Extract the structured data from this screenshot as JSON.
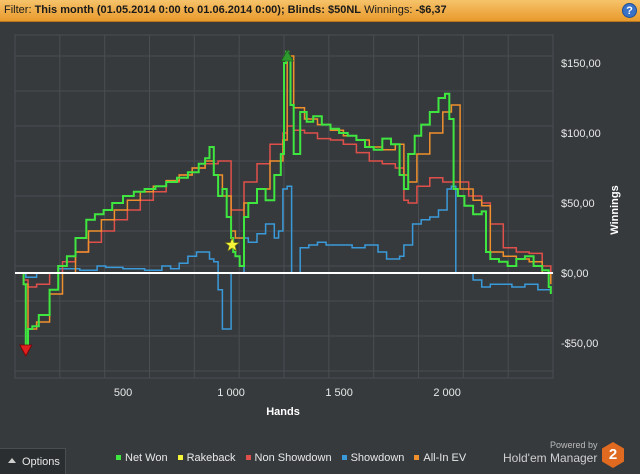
{
  "filter_bar": {
    "prefix": "Filter: ",
    "filter_text": "This month (01.05.2014 0:00 to 01.06.2014 0:00); Blinds: $50NL",
    "winnings_label": " Winnings: ",
    "winnings_value": "-$6,37",
    "help_icon": "?"
  },
  "options_button": {
    "label": "Options",
    "icon": "triangle-up-icon"
  },
  "powered_by": "Powered by",
  "brand": "Hold'em Manager",
  "brand_logo_text": "2",
  "colors": {
    "background": "#363a3d",
    "grid": "#4a4e52",
    "zero_line": "#ffffff",
    "net_won": "#3fe63f",
    "rakeback": "#f5f53a",
    "non_showdown": "#e0504a",
    "showdown": "#3a9ad9",
    "all_in_ev": "#f0902c",
    "filter_bar": "#f0a840"
  },
  "chart_data": {
    "type": "line",
    "xlabel": "Hands",
    "ylabel": "Winnings",
    "xlim": [
      0,
      2490
    ],
    "ylim": [
      -75,
      170
    ],
    "x_ticks": [
      500,
      1000,
      1500,
      2000
    ],
    "x_tick_labels": [
      "500",
      "1 000",
      "1 500",
      "2 000"
    ],
    "y_ticks": [
      150,
      100,
      50,
      0,
      -50
    ],
    "y_tick_labels": [
      "$150,00",
      "$100,00",
      "$50,00",
      "$0,00",
      "-$50,00"
    ],
    "grid": true,
    "legend": "bottom",
    "markers": [
      {
        "name": "min",
        "shape": "triangle-down",
        "x": 50,
        "y": -55,
        "color": "#e02020"
      },
      {
        "name": "rakeback",
        "shape": "star",
        "x": 1005,
        "y": 20,
        "color": "#f5f53a"
      },
      {
        "name": "max",
        "shape": "triangle-up",
        "x": 1260,
        "y": 155,
        "color": "#2e9a2e"
      }
    ],
    "series": [
      {
        "name": "Net Won",
        "color": "#3fe63f",
        "x": [
          0,
          40,
          50,
          60,
          80,
          110,
          160,
          200,
          240,
          280,
          330,
          370,
          410,
          450,
          500,
          550,
          600,
          650,
          700,
          750,
          800,
          850,
          880,
          900,
          920,
          940,
          960,
          980,
          1000,
          1010,
          1020,
          1040,
          1060,
          1080,
          1120,
          1160,
          1200,
          1230,
          1245,
          1255,
          1265,
          1275,
          1290,
          1320,
          1350,
          1380,
          1420,
          1460,
          1500,
          1540,
          1580,
          1620,
          1660,
          1700,
          1740,
          1780,
          1800,
          1820,
          1850,
          1880,
          1920,
          1960,
          1990,
          2010,
          2030,
          2050,
          2080,
          2120,
          2160,
          2180,
          2200,
          2240,
          2280,
          2320,
          2360,
          2400,
          2440,
          2470,
          2480
        ],
        "y": [
          0,
          -8,
          -52,
          -40,
          -38,
          -30,
          -12,
          5,
          12,
          25,
          38,
          42,
          45,
          50,
          55,
          58,
          60,
          62,
          65,
          68,
          72,
          78,
          82,
          90,
          70,
          55,
          60,
          40,
          25,
          15,
          12,
          5,
          40,
          50,
          60,
          52,
          70,
          85,
          150,
          158,
          152,
          120,
          85,
          115,
          108,
          112,
          106,
          103,
          100,
          98,
          95,
          90,
          88,
          96,
          92,
          70,
          60,
          85,
          98,
          106,
          115,
          125,
          128,
          110,
          60,
          55,
          48,
          42,
          44,
          15,
          10,
          8,
          5,
          10,
          12,
          5,
          2,
          -10,
          -15
        ]
      },
      {
        "name": "Rakeback",
        "color": "#f5f53a",
        "x": [
          1005
        ],
        "y": [
          20
        ]
      },
      {
        "name": "Non Showdown",
        "color": "#e0504a",
        "x": [
          0,
          40,
          60,
          100,
          160,
          220,
          280,
          340,
          400,
          460,
          520,
          580,
          640,
          700,
          760,
          820,
          880,
          940,
          1000,
          1060,
          1120,
          1180,
          1240,
          1260,
          1290,
          1340,
          1400,
          1460,
          1520,
          1580,
          1640,
          1700,
          1760,
          1800,
          1820,
          1860,
          1920,
          1980,
          2040,
          2100,
          2160,
          2200,
          2260,
          2320,
          2380,
          2440,
          2480
        ],
        "y": [
          0,
          -5,
          -10,
          -8,
          0,
          8,
          15,
          22,
          30,
          38,
          45,
          52,
          58,
          65,
          70,
          75,
          78,
          80,
          45,
          65,
          78,
          92,
          100,
          105,
          102,
          100,
          96,
          95,
          92,
          86,
          80,
          78,
          75,
          52,
          50,
          62,
          68,
          65,
          65,
          55,
          50,
          35,
          18,
          15,
          14,
          5,
          -5
        ]
      },
      {
        "name": "Showdown",
        "color": "#3a9ad9",
        "x": [
          0,
          50,
          100,
          200,
          300,
          380,
          420,
          500,
          560,
          600,
          640,
          680,
          720,
          760,
          800,
          840,
          900,
          920,
          940,
          960,
          980,
          1000,
          1060,
          1080,
          1120,
          1160,
          1200,
          1220,
          1240,
          1260,
          1280,
          1320,
          1360,
          1400,
          1440,
          1500,
          1560,
          1620,
          1680,
          1720,
          1780,
          1800,
          1840,
          1880,
          1920,
          1960,
          2000,
          2020,
          2040,
          2080,
          2120,
          2160,
          2200,
          2240,
          2300,
          2360,
          2420,
          2480
        ],
        "y": [
          0,
          -3,
          0,
          3,
          2,
          5,
          4,
          3,
          3,
          2,
          2,
          5,
          3,
          7,
          12,
          15,
          10,
          8,
          -12,
          -40,
          -40,
          0,
          25,
          22,
          28,
          35,
          25,
          30,
          60,
          62,
          0,
          18,
          20,
          22,
          20,
          20,
          18,
          20,
          15,
          10,
          12,
          20,
          35,
          38,
          40,
          45,
          60,
          62,
          0,
          0,
          -5,
          -10,
          -8,
          -8,
          -10,
          -8,
          -12,
          -12
        ]
      },
      {
        "name": "All-In EV",
        "color": "#f0902c",
        "x": [
          0,
          40,
          60,
          100,
          160,
          220,
          280,
          340,
          400,
          460,
          520,
          580,
          640,
          700,
          760,
          820,
          880,
          920,
          960,
          1000,
          1020,
          1060,
          1120,
          1180,
          1240,
          1260,
          1290,
          1340,
          1400,
          1460,
          1520,
          1580,
          1640,
          1700,
          1760,
          1800,
          1820,
          1860,
          1920,
          1980,
          2020,
          2060,
          2120,
          2160,
          2200,
          2260,
          2320,
          2380,
          2440,
          2480
        ],
        "y": [
          0,
          -8,
          -40,
          -35,
          -15,
          0,
          15,
          30,
          38,
          45,
          52,
          58,
          62,
          66,
          70,
          75,
          80,
          70,
          55,
          30,
          25,
          50,
          60,
          80,
          95,
          155,
          118,
          110,
          106,
          102,
          98,
          95,
          90,
          88,
          92,
          70,
          65,
          85,
          100,
          115,
          120,
          60,
          52,
          48,
          15,
          12,
          10,
          8,
          0,
          -8
        ]
      }
    ]
  }
}
